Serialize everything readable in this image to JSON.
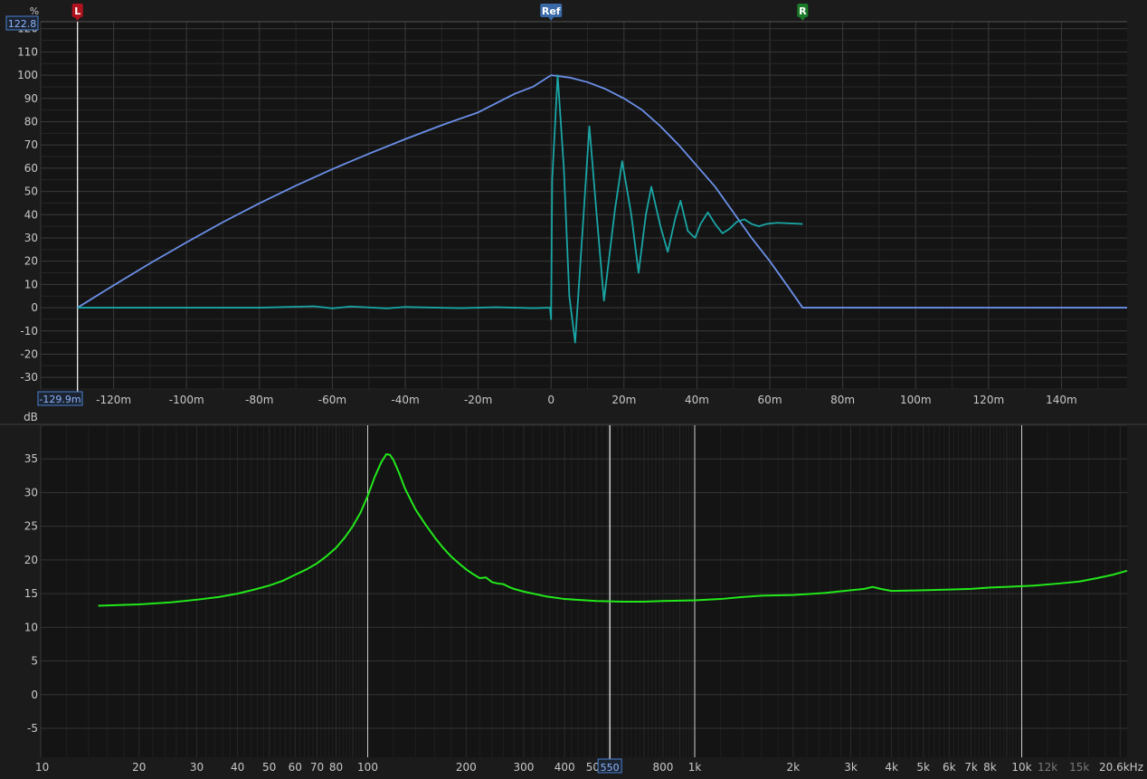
{
  "chart_data": [
    {
      "type": "line",
      "ylabel": "%",
      "xlim_ms": [
        -140,
        158
      ],
      "ylim": [
        -35,
        123
      ],
      "x_ticks": [
        {
          "v": -120,
          "label": "-120m"
        },
        {
          "v": -100,
          "label": "-100m"
        },
        {
          "v": -80,
          "label": "-80m"
        },
        {
          "v": -60,
          "label": "-60m"
        },
        {
          "v": -40,
          "label": "-40m"
        },
        {
          "v": -20,
          "label": "-20m"
        },
        {
          "v": 0,
          "label": "0"
        },
        {
          "v": 20,
          "label": "20m"
        },
        {
          "v": 40,
          "label": "40m"
        },
        {
          "v": 60,
          "label": "60m"
        },
        {
          "v": 80,
          "label": "80m"
        },
        {
          "v": 100,
          "label": "100m"
        },
        {
          "v": 120,
          "label": "120m"
        },
        {
          "v": 140,
          "label": "140m"
        }
      ],
      "y_ticks": [
        120,
        110,
        100,
        90,
        80,
        70,
        60,
        50,
        40,
        30,
        20,
        10,
        0,
        -10,
        -20,
        -30
      ],
      "markers": {
        "left": "L",
        "ref": "Ref",
        "right": "R"
      },
      "marker_positions_ms": {
        "left": -129.9,
        "ref": 0,
        "right": 69
      },
      "cursor": {
        "x_label": "-129.9m",
        "y_label": "122.8"
      },
      "series": [
        {
          "name": "",
          "color": "#6b8fe8",
          "points": [
            [
              -129.9,
              0
            ],
            [
              -120,
              9.6
            ],
            [
              -110,
              19.1
            ],
            [
              -100,
              28.1
            ],
            [
              -90,
              36.8
            ],
            [
              -80,
              44.9
            ],
            [
              -70,
              52.5
            ],
            [
              -60,
              59.6
            ],
            [
              -50,
              66.2
            ],
            [
              -40,
              72.5
            ],
            [
              -30,
              78.5
            ],
            [
              -20,
              84
            ],
            [
              -10,
              92
            ],
            [
              -5,
              95
            ],
            [
              0,
              100
            ],
            [
              5,
              99
            ],
            [
              10,
              97
            ],
            [
              15,
              94
            ],
            [
              20,
              90
            ],
            [
              25,
              85
            ],
            [
              30,
              78
            ],
            [
              35,
              70
            ],
            [
              40,
              61
            ],
            [
              45,
              52
            ],
            [
              50,
              41
            ],
            [
              55,
              30
            ],
            [
              60,
              20
            ],
            [
              65,
              9
            ],
            [
              69,
              0
            ],
            [
              158,
              0
            ]
          ]
        },
        {
          "name": "",
          "color": "#1aa5a5",
          "points": [
            [
              -129.9,
              0
            ],
            [
              -80,
              0
            ],
            [
              -65,
              0.6
            ],
            [
              -60,
              -0.3
            ],
            [
              -55,
              0.5
            ],
            [
              -45,
              -0.3
            ],
            [
              -40,
              0.3
            ],
            [
              -25,
              -0.2
            ],
            [
              -15,
              0.2
            ],
            [
              -5,
              -0.2
            ],
            [
              -0.3,
              0
            ],
            [
              0,
              -5
            ],
            [
              0.3,
              55
            ],
            [
              1.8,
              100
            ],
            [
              3.5,
              60
            ],
            [
              5,
              5
            ],
            [
              6.6,
              -15
            ],
            [
              8.5,
              30
            ],
            [
              10.5,
              78
            ],
            [
              12.5,
              40
            ],
            [
              14.5,
              3
            ],
            [
              17.5,
              42
            ],
            [
              19.5,
              63
            ],
            [
              22,
              40
            ],
            [
              24,
              15
            ],
            [
              26,
              40
            ],
            [
              27.5,
              52
            ],
            [
              30,
              35
            ],
            [
              32,
              24
            ],
            [
              34,
              38
            ],
            [
              35.5,
              46
            ],
            [
              37.5,
              33
            ],
            [
              39.5,
              30
            ],
            [
              41,
              36
            ],
            [
              43,
              41
            ],
            [
              45,
              36
            ],
            [
              47,
              32
            ],
            [
              49,
              34
            ],
            [
              51,
              37
            ],
            [
              53,
              38
            ],
            [
              55,
              36
            ],
            [
              57,
              35
            ],
            [
              59,
              36
            ],
            [
              62,
              36.5
            ],
            [
              69,
              36
            ]
          ]
        }
      ]
    },
    {
      "type": "line",
      "ylabel": "dB",
      "xscale": "log",
      "xlim": [
        10,
        21000
      ],
      "ylim": [
        -9.3,
        40
      ],
      "x_ticks": [
        {
          "v": 10,
          "label": "10"
        },
        {
          "v": 20,
          "label": "20"
        },
        {
          "v": 30,
          "label": "30"
        },
        {
          "v": 40,
          "label": "40"
        },
        {
          "v": 50,
          "label": "50"
        },
        {
          "v": 60,
          "label": "60"
        },
        {
          "v": 70,
          "label": "70"
        },
        {
          "v": 80,
          "label": "80"
        },
        {
          "v": 100,
          "label": "100"
        },
        {
          "v": 200,
          "label": "200"
        },
        {
          "v": 300,
          "label": "300"
        },
        {
          "v": 400,
          "label": "400"
        },
        {
          "v": 500,
          "label": "500"
        },
        {
          "v": 800,
          "label": "800"
        },
        {
          "v": 1000,
          "label": "1k"
        },
        {
          "v": 2000,
          "label": "2k"
        },
        {
          "v": 3000,
          "label": "3k"
        },
        {
          "v": 4000,
          "label": "4k"
        },
        {
          "v": 5000,
          "label": "5k"
        },
        {
          "v": 6000,
          "label": "6k"
        },
        {
          "v": 7000,
          "label": "7k"
        },
        {
          "v": 8000,
          "label": "8k"
        },
        {
          "v": 10000,
          "label": "10k"
        },
        {
          "v": 12000,
          "label": "12k",
          "dim": true
        },
        {
          "v": 15000,
          "label": "15k",
          "dim": true
        },
        {
          "v": 20600,
          "label": "20.6kHz"
        }
      ],
      "y_ticks": [
        35,
        30,
        25,
        20,
        15,
        10,
        5,
        0,
        -5
      ],
      "cursor": {
        "x_label": "550",
        "x_value": 550
      },
      "highlight_lines": [
        100,
        1000,
        10000
      ],
      "series": [
        {
          "name": "",
          "color": "#22e81a",
          "points": [
            [
              15,
              13.2
            ],
            [
              20,
              13.4
            ],
            [
              25,
              13.7
            ],
            [
              30,
              14.1
            ],
            [
              35,
              14.5
            ],
            [
              40,
              15.0
            ],
            [
              45,
              15.6
            ],
            [
              50,
              16.2
            ],
            [
              55,
              16.9
            ],
            [
              60,
              17.8
            ],
            [
              65,
              18.6
            ],
            [
              70,
              19.5
            ],
            [
              75,
              20.6
            ],
            [
              80,
              21.8
            ],
            [
              85,
              23.3
            ],
            [
              90,
              25.0
            ],
            [
              95,
              27.0
            ],
            [
              100,
              29.5
            ],
            [
              105,
              32.3
            ],
            [
              110,
              34.5
            ],
            [
              114,
              35.7
            ],
            [
              117,
              35.6
            ],
            [
              120,
              34.8
            ],
            [
              125,
              32.8
            ],
            [
              130,
              30.6
            ],
            [
              140,
              27.5
            ],
            [
              150,
              25.3
            ],
            [
              160,
              23.4
            ],
            [
              170,
              21.8
            ],
            [
              180,
              20.5
            ],
            [
              190,
              19.5
            ],
            [
              200,
              18.6
            ],
            [
              210,
              17.9
            ],
            [
              220,
              17.3
            ],
            [
              230,
              17.4
            ],
            [
              240,
              16.7
            ],
            [
              250,
              16.5
            ],
            [
              260,
              16.4
            ],
            [
              270,
              16.0
            ],
            [
              280,
              15.7
            ],
            [
              300,
              15.3
            ],
            [
              350,
              14.6
            ],
            [
              400,
              14.2
            ],
            [
              500,
              13.9
            ],
            [
              600,
              13.8
            ],
            [
              700,
              13.8
            ],
            [
              800,
              13.9
            ],
            [
              1000,
              14.0
            ],
            [
              1200,
              14.2
            ],
            [
              1400,
              14.5
            ],
            [
              1600,
              14.7
            ],
            [
              2000,
              14.8
            ],
            [
              2500,
              15.1
            ],
            [
              3000,
              15.5
            ],
            [
              3300,
              15.7
            ],
            [
              3500,
              16.0
            ],
            [
              3700,
              15.7
            ],
            [
              4000,
              15.4
            ],
            [
              5000,
              15.5
            ],
            [
              6000,
              15.6
            ],
            [
              7000,
              15.7
            ],
            [
              8000,
              15.9
            ],
            [
              9000,
              16.0
            ],
            [
              10000,
              16.1
            ],
            [
              11000,
              16.2
            ],
            [
              13000,
              16.5
            ],
            [
              15000,
              16.8
            ],
            [
              17000,
              17.3
            ],
            [
              19000,
              17.8
            ],
            [
              21000,
              18.4
            ]
          ]
        }
      ]
    }
  ]
}
